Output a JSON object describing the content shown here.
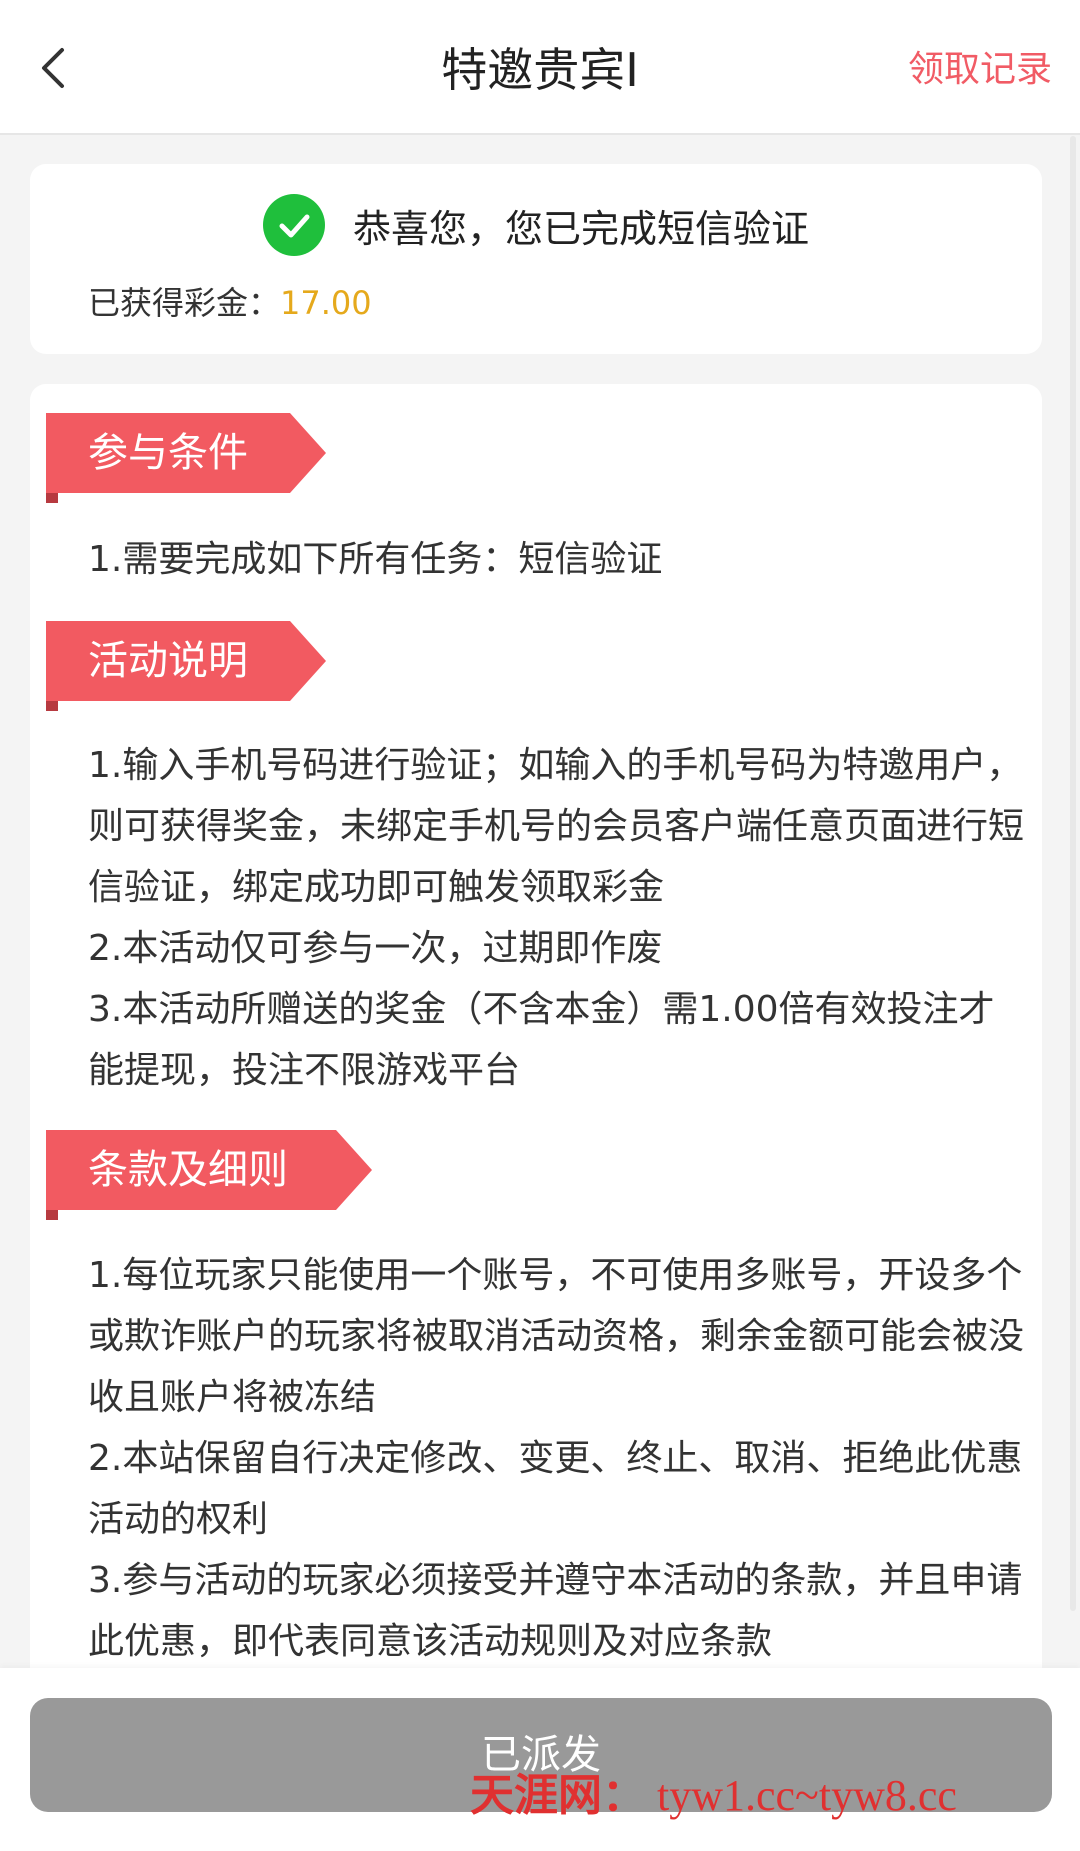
{
  "header": {
    "title": "特邀贵宾I",
    "right_link": "领取记录",
    "accent_color": "#f15b65"
  },
  "success": {
    "message": "恭喜您，您已完成短信验证",
    "bonus_label": "已获得彩金：",
    "bonus_value": "17.00"
  },
  "sections": [
    {
      "tag": "参与条件",
      "paragraphs": [
        "1.需要完成如下所有任务：短信验证"
      ]
    },
    {
      "tag": "活动说明",
      "paragraphs": [
        "1.输入手机号码进行验证；如输入的手机号码为特邀用户，则可获得奖金，未绑定手机号的会员客户端任意页面进行短信验证，绑定成功即可触发领取彩金",
        "2.本活动仅可参与一次，过期即作废",
        "3.本活动所赠送的奖金（不含本金）需1.00倍有效投注才能提现，投注不限游戏平台"
      ]
    },
    {
      "tag": "条款及细则",
      "paragraphs": [
        "1.每位玩家只能使用一个账号，不可使用多账号，开设多个或欺诈账户的玩家将被取消活动资格，剩余金额可能会被没收且账户将被冻结",
        "2.本站保留自行决定修改、变更、终止、取消、拒绝此优惠活动的权利",
        "3.参与活动的玩家必须接受并遵守本活动的条款，并且申请此优惠，即代表同意该活动规则及对应条款"
      ]
    }
  ],
  "bottom": {
    "button_label": "已派发",
    "button_color": "#999999"
  },
  "watermark": {
    "brand": "天涯网：",
    "urls": "tyw1.cc~tyw8.cc"
  },
  "icons": {
    "back": "chevron-left-icon",
    "success": "check-circle-icon"
  }
}
